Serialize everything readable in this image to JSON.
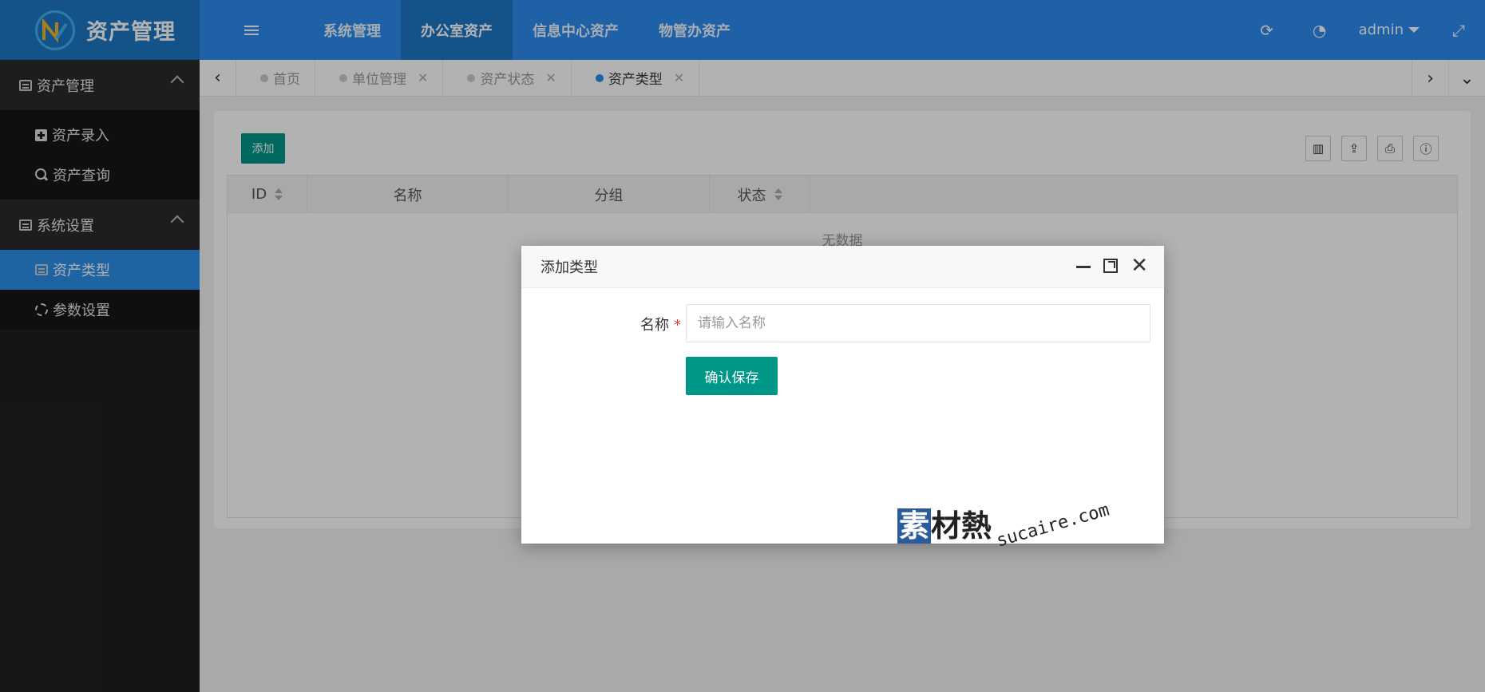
{
  "app": {
    "logo_text": "资产管理"
  },
  "topnav": {
    "tabs": [
      {
        "label": "系统管理"
      },
      {
        "label": "办公室资产"
      },
      {
        "label": "信息中心资产"
      },
      {
        "label": "物管办资产"
      }
    ],
    "user": "admin"
  },
  "sidebar": {
    "groups": [
      {
        "label": "资产管理",
        "items": [
          {
            "label": "资产录入"
          },
          {
            "label": "资产查询"
          }
        ]
      },
      {
        "label": "系统设置",
        "items": [
          {
            "label": "资产类型"
          },
          {
            "label": "参数设置"
          }
        ]
      }
    ]
  },
  "pagetabs": [
    {
      "label": "首页"
    },
    {
      "label": "单位管理"
    },
    {
      "label": "资产状态"
    },
    {
      "label": "资产类型"
    }
  ],
  "toolbar": {
    "add_label": "添加"
  },
  "table": {
    "columns": [
      {
        "label": "ID"
      },
      {
        "label": "名称"
      },
      {
        "label": "分组"
      },
      {
        "label": "状态"
      }
    ],
    "empty_text": "无数据"
  },
  "dialog": {
    "title": "添加类型",
    "name_label": "名称",
    "required_mark": "*",
    "name_placeholder": "请输入名称",
    "save_label": "确认保存"
  },
  "watermark": {
    "logo": "素材熱",
    "logo_first": "素",
    "logo_rest": "材熱",
    "url": "sucaire.com"
  }
}
